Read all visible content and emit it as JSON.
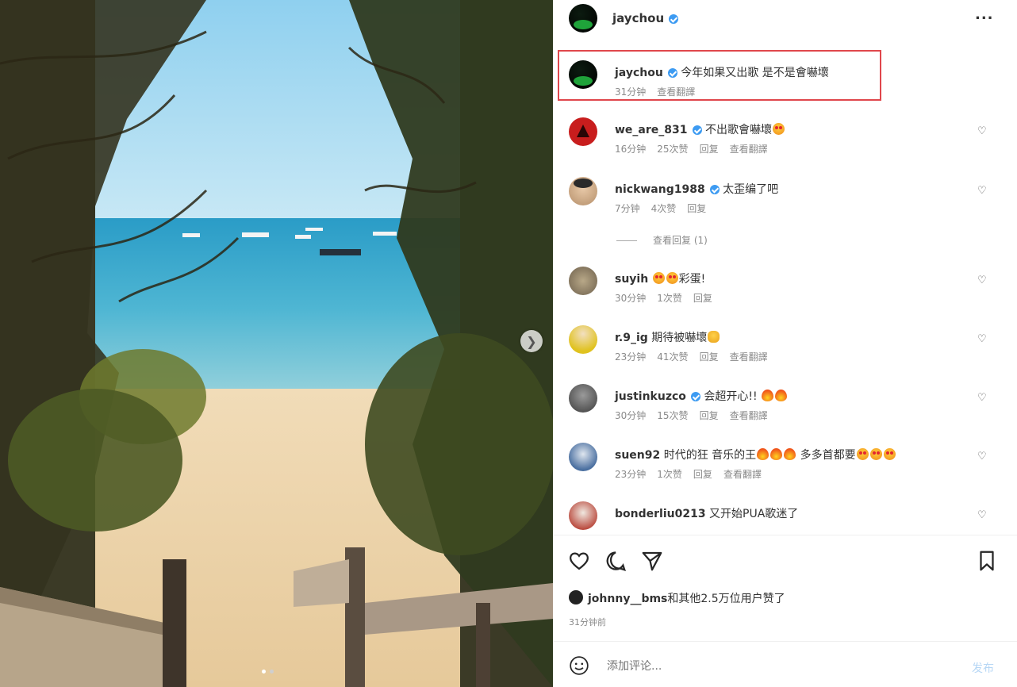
{
  "post": {
    "username": "jaychou",
    "more_label": "...",
    "caption": "今年如果又出歌 是不是會嚇壞",
    "caption_time": "31分钟",
    "caption_translate": "查看翻譯"
  },
  "comments": [
    {
      "user": "we_are_831",
      "verified": true,
      "text": "不出歌會嚇壞",
      "emoji": [
        "hearteyes"
      ],
      "time": "16分钟",
      "likes": "25次赞",
      "reply": "回复",
      "translate": "查看翻譯",
      "avatar_color": "#c81d1d"
    },
    {
      "user": "nickwang1988",
      "verified": true,
      "text": "太歪编了吧",
      "emoji": [],
      "time": "7分钟",
      "likes": "4次赞",
      "reply": "回复",
      "translate": "",
      "avatar_color": "#d9c3a8"
    },
    {
      "user": "suyih",
      "verified": false,
      "text": "彩蛋!",
      "emoji_before": [
        "hearteyes",
        "hearteyes"
      ],
      "emoji": [],
      "time": "30分钟",
      "likes": "1次赞",
      "reply": "回复",
      "translate": "",
      "avatar_color": "#9a8c75"
    },
    {
      "user": "r.9_ig",
      "verified": false,
      "text": "期待被嚇壞",
      "emoji": [
        "clap"
      ],
      "time": "23分钟",
      "likes": "41次赞",
      "reply": "回复",
      "translate": "查看翻譯",
      "avatar_color": "#e6d34a"
    },
    {
      "user": "justinkuzco",
      "verified": true,
      "text": "会超开心!!",
      "emoji": [
        "fire",
        "fire"
      ],
      "time": "30分钟",
      "likes": "15次赞",
      "reply": "回复",
      "translate": "查看翻譯",
      "avatar_color": "#5a5a5a"
    },
    {
      "user": "suen92",
      "verified": false,
      "text": "时代的狂 音乐的王",
      "text2": "多多首都要",
      "emoji": [
        "fire",
        "fire",
        "fire"
      ],
      "emoji2": [
        "hearteyes",
        "hearteyes",
        "hearteyes"
      ],
      "time": "23分钟",
      "likes": "1次赞",
      "reply": "回复",
      "translate": "查看翻譯",
      "avatar_color": "#4a6fa0"
    },
    {
      "user": "bonderliu0213",
      "verified": false,
      "text": "又开始PUA歌迷了",
      "emoji": [],
      "time": "",
      "likes": "",
      "reply": "",
      "translate": "",
      "avatar_color": "#c8b9a8"
    }
  ],
  "view_replies": "查看回复 (1)",
  "likes_line": {
    "user": "johnny__bms",
    "rest": "和其他2.5万位用户赞了"
  },
  "post_time": "31分钟前",
  "comment_input": {
    "placeholder": "添加评论..."
  },
  "post_button": "发布",
  "colors": {
    "highlight": "#e0474c",
    "verified": "#3d9bf2",
    "post": "#b7d7f5"
  }
}
